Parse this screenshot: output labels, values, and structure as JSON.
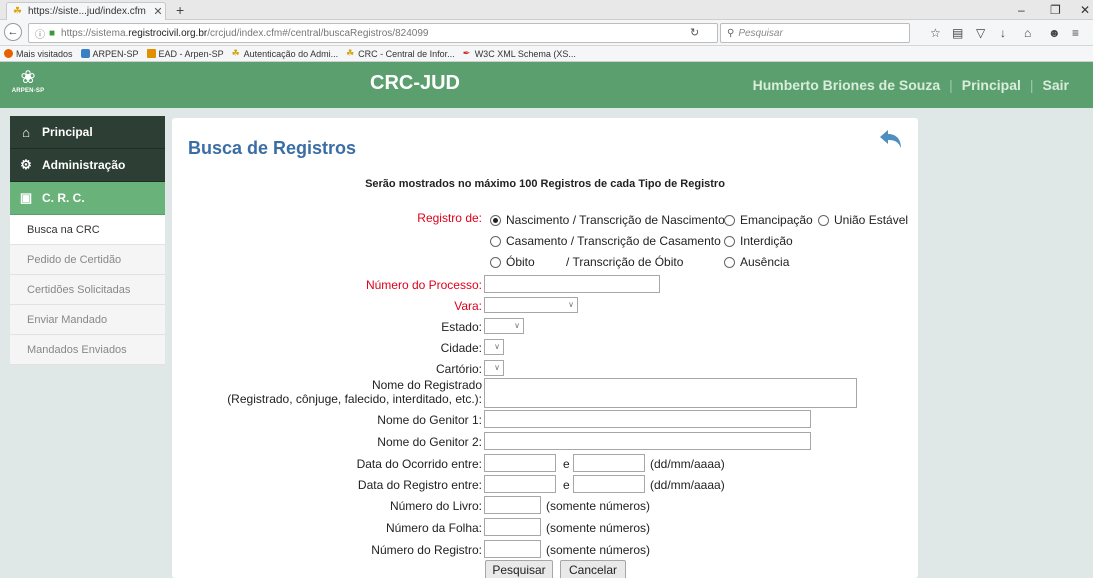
{
  "browser": {
    "tab_title": "https://siste...jud/index.cfm",
    "url_prefix": "https://sistema.",
    "url_host": "registrocivil.org.br",
    "url_path": "/crcjud/index.cfm#/central/buscaRegistros/824099",
    "search_placeholder": "Pesquisar",
    "bookmarks": [
      {
        "label": "Mais visitados",
        "icon": "firefox-icon",
        "color": "#e66000"
      },
      {
        "label": "ARPEN-SP",
        "icon": "arpen-icon",
        "color": "#3a7fc4"
      },
      {
        "label": "EAD - Arpen-SP",
        "icon": "ead-icon",
        "color": "#e09000"
      },
      {
        "label": "Autenticação do Admi...",
        "icon": "crc-icon",
        "color": "#d0a000"
      },
      {
        "label": "CRC - Central de Infor...",
        "icon": "crc-icon",
        "color": "#d0a000"
      },
      {
        "label": "W3C XML Schema (XS...",
        "icon": "w3c-icon",
        "color": "#cc2222"
      }
    ]
  },
  "header": {
    "app_title": "CRC-JUD",
    "logo_text": "ARPEN-SP",
    "user_name": "Humberto Briones de Souza",
    "link_principal": "Principal",
    "link_sair": "Sair",
    "color": "#5c9f6e"
  },
  "sidebar": {
    "main_items": [
      {
        "label": "Principal",
        "icon": "home-icon"
      },
      {
        "label": "Administração",
        "icon": "gear-icon"
      },
      {
        "label": "C. R. C.",
        "icon": "inbox-icon"
      }
    ],
    "sub_items": [
      "Busca na CRC",
      "Pedido de Certidão",
      "Certidões Solicitadas",
      "Enviar Mandado",
      "Mandados Enviados"
    ]
  },
  "form": {
    "title": "Busca de Registros",
    "notice": "Serão mostrados no máximo 100 Registros de cada Tipo de Registro",
    "registro_label": "Registro de:",
    "registro_options": [
      {
        "label": "Nascimento / Transcrição de Nascimento",
        "checked": true
      },
      {
        "label": "Emancipação",
        "checked": false
      },
      {
        "label": "União Estável",
        "checked": false
      },
      {
        "label": "Casamento / Transcrição de Casamento",
        "checked": false
      },
      {
        "label": "Interdição",
        "checked": false
      },
      {
        "label": "Óbito",
        "checked": false
      },
      {
        "label": "/ Transcrição de Óbito",
        "checked": false
      },
      {
        "label": "Ausência",
        "checked": false
      }
    ],
    "numero_processo_label": "Número do Processo:",
    "numero_processo_value": "",
    "vara_label": "Vara:",
    "vara_value": "",
    "estado_label": "Estado:",
    "estado_value": "",
    "cidade_label": "Cidade:",
    "cidade_value": "",
    "cartorio_label": "Cartório:",
    "cartorio_value": "",
    "nome_registrado_label_1": "Nome do Registrado",
    "nome_registrado_label_2": "(Registrado, cônjuge, falecido, interditado, etc.):",
    "nome_registrado_value": "",
    "genitor1_label": "Nome do Genitor 1:",
    "genitor1_value": "",
    "genitor2_label": "Nome do Genitor 2:",
    "genitor2_value": "",
    "data_ocorrido_label": "Data do Ocorrido entre:",
    "data_registro_label": "Data do Registro entre:",
    "and_text": "e",
    "date_hint": "(dd/mm/aaaa)",
    "livro_label": "Número do Livro:",
    "folha_label": "Número da Folha:",
    "registro_num_label": "Número do Registro:",
    "numbers_hint": "(somente números)",
    "btn_pesquisar": "Pesquisar",
    "btn_cancelar": "Cancelar"
  }
}
